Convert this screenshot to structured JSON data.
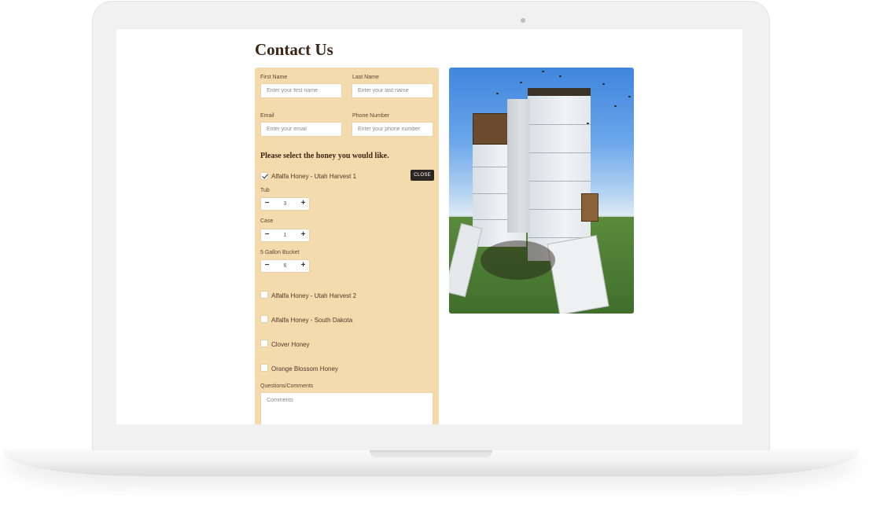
{
  "page": {
    "title": "Contact Us"
  },
  "form": {
    "first_name": {
      "label": "First Name",
      "placeholder": "Enter your first name"
    },
    "last_name": {
      "label": "Last Name",
      "placeholder": "Enter your last name"
    },
    "email": {
      "label": "Email",
      "placeholder": "Enter your email"
    },
    "phone": {
      "label": "Phone Number",
      "placeholder": "Enter your phone number"
    },
    "honey_heading": "Please select the honey you would like.",
    "close_label": "CLOSE",
    "options": [
      {
        "label": "Alfalfa Honey - Utah Harvest 1",
        "checked": true
      },
      {
        "label": "Alfalfa Honey - Utah Harvest 2",
        "checked": false
      },
      {
        "label": "Alfalfa Honey - South Dakota",
        "checked": false
      },
      {
        "label": "Clover Honey",
        "checked": false
      },
      {
        "label": "Orange Blossom Honey",
        "checked": false
      }
    ],
    "quantities": [
      {
        "label": "Tub",
        "value": "3"
      },
      {
        "label": "Case",
        "value": "1"
      },
      {
        "label": "5 Gallon Bucket",
        "value": "6"
      }
    ],
    "stepper": {
      "minus": "−",
      "plus": "+"
    },
    "comments": {
      "label": "Questions/Comments",
      "placeholder": "Comments"
    }
  },
  "colors": {
    "form_background": "#f4dbae",
    "title_text": "#3d2616",
    "close_button": "#2c2623"
  },
  "icons": {
    "checkbox_checked": "checkmark-icon",
    "stepper_minus": "minus-icon",
    "stepper_plus": "plus-icon"
  }
}
